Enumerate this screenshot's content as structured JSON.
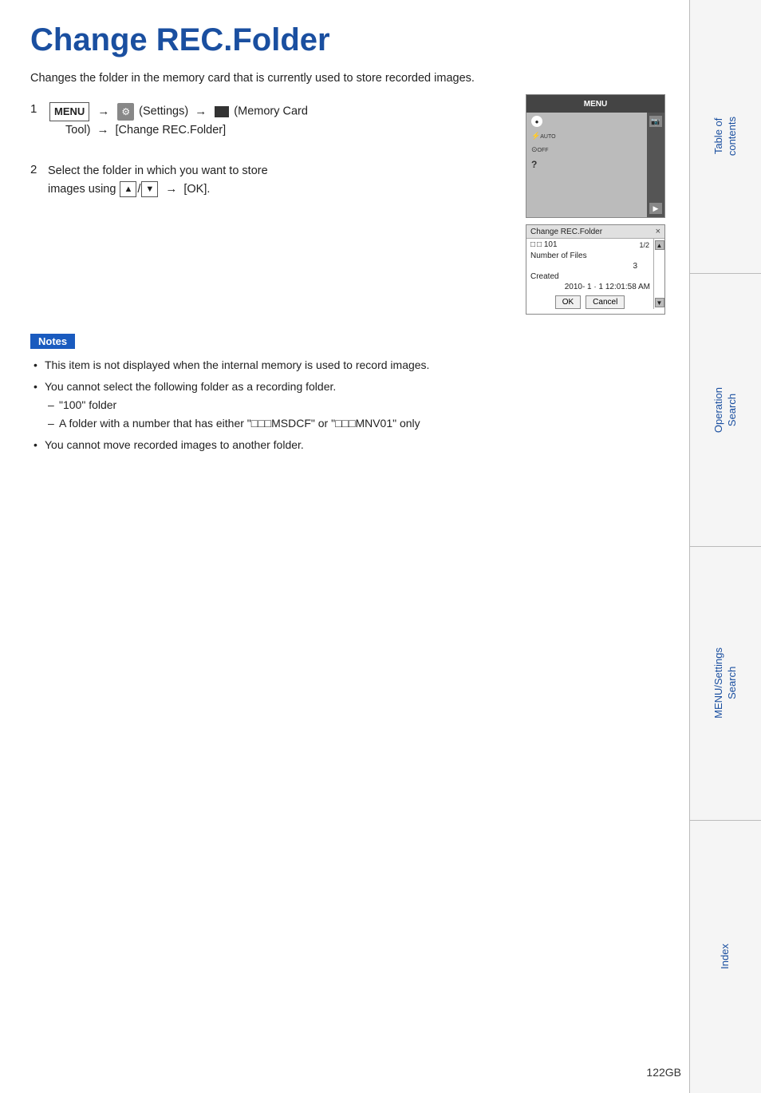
{
  "page": {
    "title": "Change REC.Folder",
    "description": "Changes the folder in the memory card that is currently used to store recorded images.",
    "page_number": "122GB"
  },
  "steps": [
    {
      "num": "1",
      "parts": [
        {
          "type": "badge",
          "text": "MENU"
        },
        {
          "type": "arrow",
          "text": "→"
        },
        {
          "type": "settings-icon"
        },
        {
          "type": "text",
          "text": " (Settings)"
        },
        {
          "type": "arrow",
          "text": "→"
        },
        {
          "type": "memory-icon"
        },
        {
          "type": "text",
          "text": " (Memory Card Tool)"
        },
        {
          "type": "arrow",
          "text": "→"
        },
        {
          "type": "text",
          "text": "[Change REC.Folder]"
        }
      ]
    },
    {
      "num": "2",
      "text": "Select the folder in which you want to store images using",
      "nav_up": "▲",
      "nav_slash": "/",
      "nav_down": "▼",
      "ok_text": "→ [OK]."
    }
  ],
  "camera_screen": {
    "top_bar": "MENU",
    "icons": [
      "●",
      "⚡AUTO",
      "⊙OFF",
      "?"
    ],
    "right_icons": [
      "📷",
      "▶"
    ],
    "dialog": {
      "title": "Change REC.Folder",
      "close": "×",
      "folder": "□ 101",
      "pagination": "1/2",
      "number_of_files_label": "Number of Files",
      "number_of_files_value": "3",
      "created_label": "Created",
      "created_value": "2010- 1 · 1 12:01:58 AM",
      "ok_btn": "OK",
      "cancel_btn": "Cancel"
    }
  },
  "notes": {
    "label": "Notes",
    "items": [
      "This item is not displayed when the internal memory is used to record images.",
      "You cannot select the following folder as a recording folder.",
      "You cannot move recorded images to another folder."
    ],
    "sub_items": [
      "\"100\" folder",
      "A folder with a number that has either \"□□□MSDCF\" or \"□□□MNV01\" only"
    ]
  },
  "sidebar": {
    "sections": [
      {
        "label": "Table of\ncontents"
      },
      {
        "label": "Operation\nSearch"
      },
      {
        "label": "MENU/Settings\nSearch"
      },
      {
        "label": "Index"
      }
    ]
  }
}
